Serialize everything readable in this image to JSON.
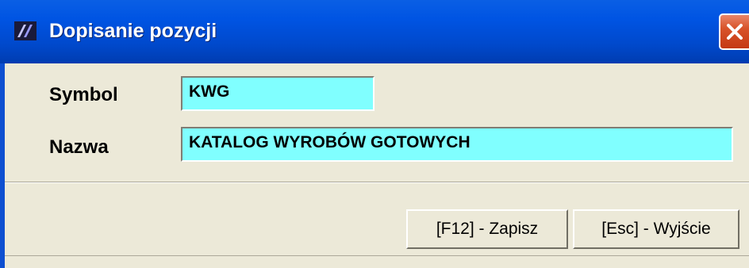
{
  "window": {
    "title": "Dopisanie pozycji",
    "app_icon": "app-logo-icon",
    "close_icon": "close-icon"
  },
  "form": {
    "symbol": {
      "label": "Symbol",
      "value": "KWG"
    },
    "nazwa": {
      "label": "Nazwa",
      "value": "KATALOG WYROBÓW GOTOWYCH"
    }
  },
  "buttons": {
    "save_label": "[F12] - Zapisz",
    "exit_label": "[Esc] - Wyjście"
  },
  "colors": {
    "titlebar": "#0054e3",
    "field_background": "#80ffff",
    "panel": "#ece9d8",
    "close_button": "#d8532a"
  }
}
